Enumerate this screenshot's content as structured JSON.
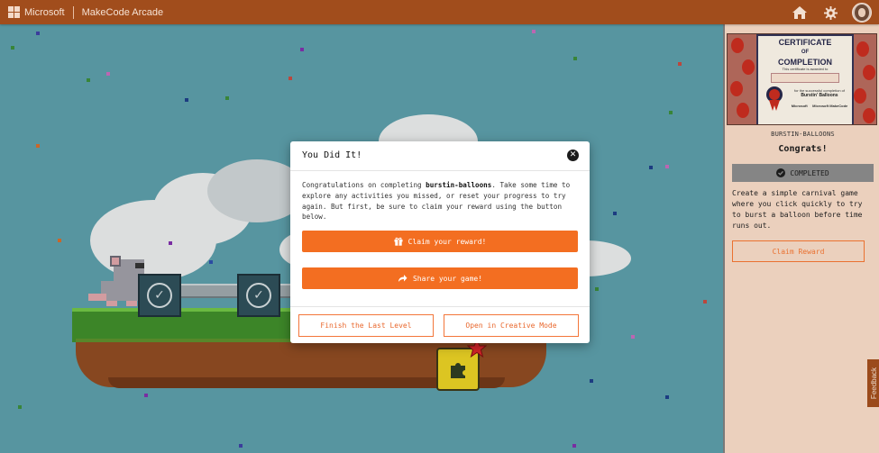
{
  "header": {
    "brand": "Microsoft",
    "app_name": "MakeCode Arcade",
    "home_icon": "home-icon",
    "settings_icon": "gear-icon"
  },
  "modal": {
    "title": "You Did It!",
    "body_prefix": "Congratulations on completing ",
    "body_bold": "burstin-balloons",
    "body_suffix": ". Take some time to explore any activities you missed, or reset your progress to try again. But first, be sure to claim your reward using the button below.",
    "claim_label": "Claim your reward!",
    "share_label": "Share your game!",
    "finish_label": "Finish the Last Level",
    "creative_label": "Open in Creative Mode"
  },
  "side_panel": {
    "certificate": {
      "title_line1": "CERTIFICATE",
      "title_of": "OF",
      "title_line2": "COMPLETION",
      "awarded_to": "This certificate is awarded to",
      "completion_text": "for the successful completion of",
      "game_name": "Burstin' Balloons",
      "ms_logo": "Microsoft",
      "mc_logo": "Microsoft MakeCode"
    },
    "subtitle": "BURSTIN-BALLOONS",
    "congrats": "Congrats!",
    "status": "COMPLETED",
    "description": "Create a simple carnival game where you click quickly to try to burst a balloon before time runs out.",
    "claim_reward": "Claim Reward"
  },
  "feedback_tab": "Feedback",
  "colors": {
    "header_bg": "#a14d1c",
    "accent": "#f36e21",
    "sidebar_bg": "#f3d7c4",
    "game_bg": "#5a9aa6"
  }
}
